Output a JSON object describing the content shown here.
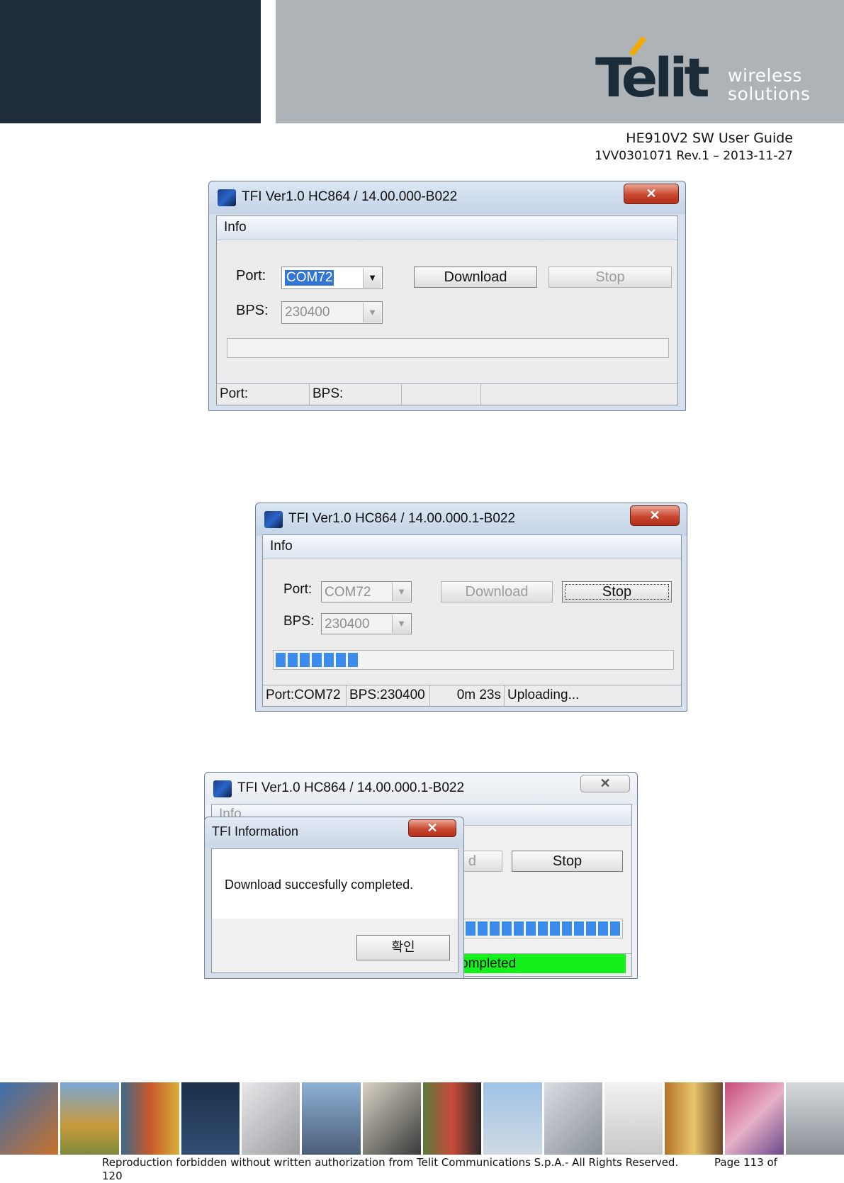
{
  "header": {
    "logo_text": "Telit",
    "logo_tagline_1": "wireless",
    "logo_tagline_2": "solutions",
    "doc_title": "HE910V2 SW User Guide",
    "doc_revision": "1VV0301071 Rev.1 – 2013-11-27"
  },
  "dialog1": {
    "title": "TFI Ver1.0   HC864 / 14.00.000-B022",
    "close_label": "✕",
    "menu_info": "Info",
    "port_label": "Port:",
    "port_value": "COM72",
    "bps_label": "BPS:",
    "bps_value": "230400",
    "download_label": "Download",
    "stop_label": "Stop",
    "progress": 0,
    "status": [
      "Port:",
      "BPS:",
      "",
      ""
    ]
  },
  "dialog2": {
    "title": "TFI Ver1.0 HC864 / 14.00.000.1-B022",
    "close_label": "✕",
    "menu_info": "Info",
    "port_label": "Port:",
    "port_value": "COM72",
    "bps_label": "BPS:",
    "bps_value": "230400",
    "download_label": "Download",
    "stop_label": "Stop",
    "progress_blocks": 7,
    "status": [
      "Port:COM72",
      "BPS:230400",
      "0m 23s",
      "Uploading..."
    ]
  },
  "dialog3": {
    "title": "TFI Ver1.0 HC864 / 14.00.000.1-B022",
    "close_label": "✕",
    "menu_info": "Info",
    "download_partial": "d",
    "stop_label": "Stop",
    "progress_blocks": 14,
    "status_text": "ompleted",
    "status_color": "#14f01a"
  },
  "info_dialog": {
    "title": "TFI Information",
    "close_label": "✕",
    "message": "Download succesfully completed.",
    "ok_label": "확인"
  },
  "footer": {
    "copyright": "Reproduction forbidden without written authorization from Telit Communications S.p.A.- All Rights Reserved.",
    "page_label": "Page 113 of",
    "page_total": "120"
  }
}
